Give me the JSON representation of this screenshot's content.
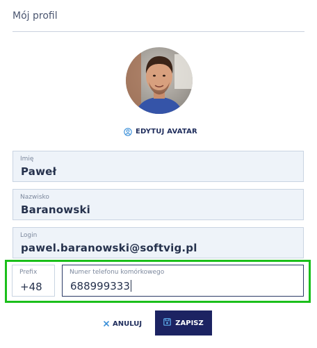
{
  "header": {
    "title": "Mój profil"
  },
  "avatar": {
    "edit_label": "EDYTUJ AVATAR",
    "icon": "user-circle-icon"
  },
  "form": {
    "first_name": {
      "label": "Imię",
      "value": "Paweł"
    },
    "last_name": {
      "label": "Nazwisko",
      "value": "Baranowski"
    },
    "login": {
      "label": "Login",
      "value": "pawel.baranowski@softvig.pl"
    },
    "prefix": {
      "label": "Prefix",
      "value": "+48"
    },
    "phone": {
      "label": "Numer telefonu komórkowego",
      "value": "688999333"
    }
  },
  "actions": {
    "cancel_label": "ANULUJ",
    "cancel_icon": "close-icon",
    "save_label": "ZAPISZ",
    "save_icon": "floppy-disk-icon"
  },
  "colors": {
    "primary": "#1c2362",
    "field_bg": "#eef3f9",
    "highlight": "#1bbf1b",
    "accent_icon": "#3a8fd8"
  }
}
